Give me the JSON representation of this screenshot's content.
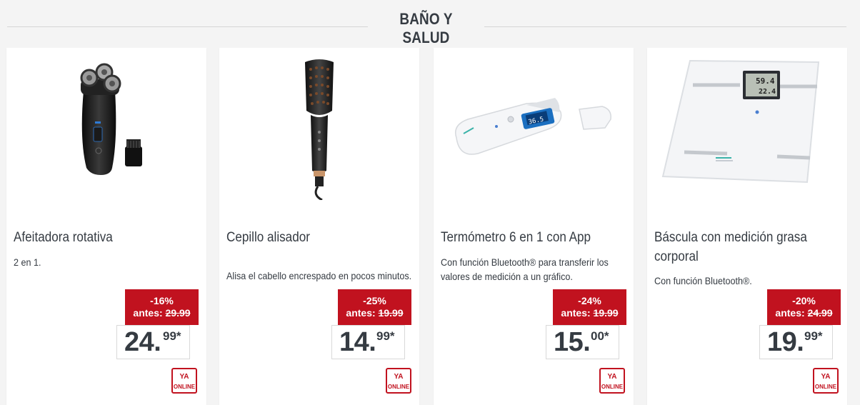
{
  "section": {
    "title": "BAÑO Y SALUD"
  },
  "products": [
    {
      "title": "Afeitadora rotativa",
      "description": "2 en 1.",
      "discount": "-16%",
      "antes_label": "antes:",
      "old_price": "29.99",
      "price_main": "24.",
      "price_cents": "99*",
      "badge_line1": "YA",
      "badge_line2": "ONLINE",
      "image_icon": "rotary-shaver-image"
    },
    {
      "title": "Cepillo alisador",
      "description": "Alisa el cabello encrespado en pocos minutos.",
      "discount": "-25%",
      "antes_label": "antes:",
      "old_price": "19.99",
      "price_main": "14.",
      "price_cents": "99*",
      "badge_line1": "YA",
      "badge_line2": "ONLINE",
      "image_icon": "straightening-brush-image"
    },
    {
      "title": "Termómetro 6 en 1 con App",
      "description": "Con función Bluetooth® para transferir los valores de medición a un gráfico.",
      "discount": "-24%",
      "antes_label": "antes:",
      "old_price": "19.99",
      "price_main": "15.",
      "price_cents": "00*",
      "badge_line1": "YA",
      "badge_line2": "ONLINE",
      "image_icon": "thermometer-image"
    },
    {
      "title": "Báscula con medición grasa corporal",
      "description": "Con función Bluetooth®.",
      "discount": "-20%",
      "antes_label": "antes:",
      "old_price": "24.99",
      "price_main": "19.",
      "price_cents": "99*",
      "badge_line1": "YA",
      "badge_line2": "ONLINE",
      "image_icon": "bathroom-scale-image",
      "scale_display": [
        "59.4",
        "22.4"
      ]
    }
  ],
  "colors": {
    "accent": "#c1121f",
    "text": "#353b42",
    "background": "#f4f4f4"
  }
}
